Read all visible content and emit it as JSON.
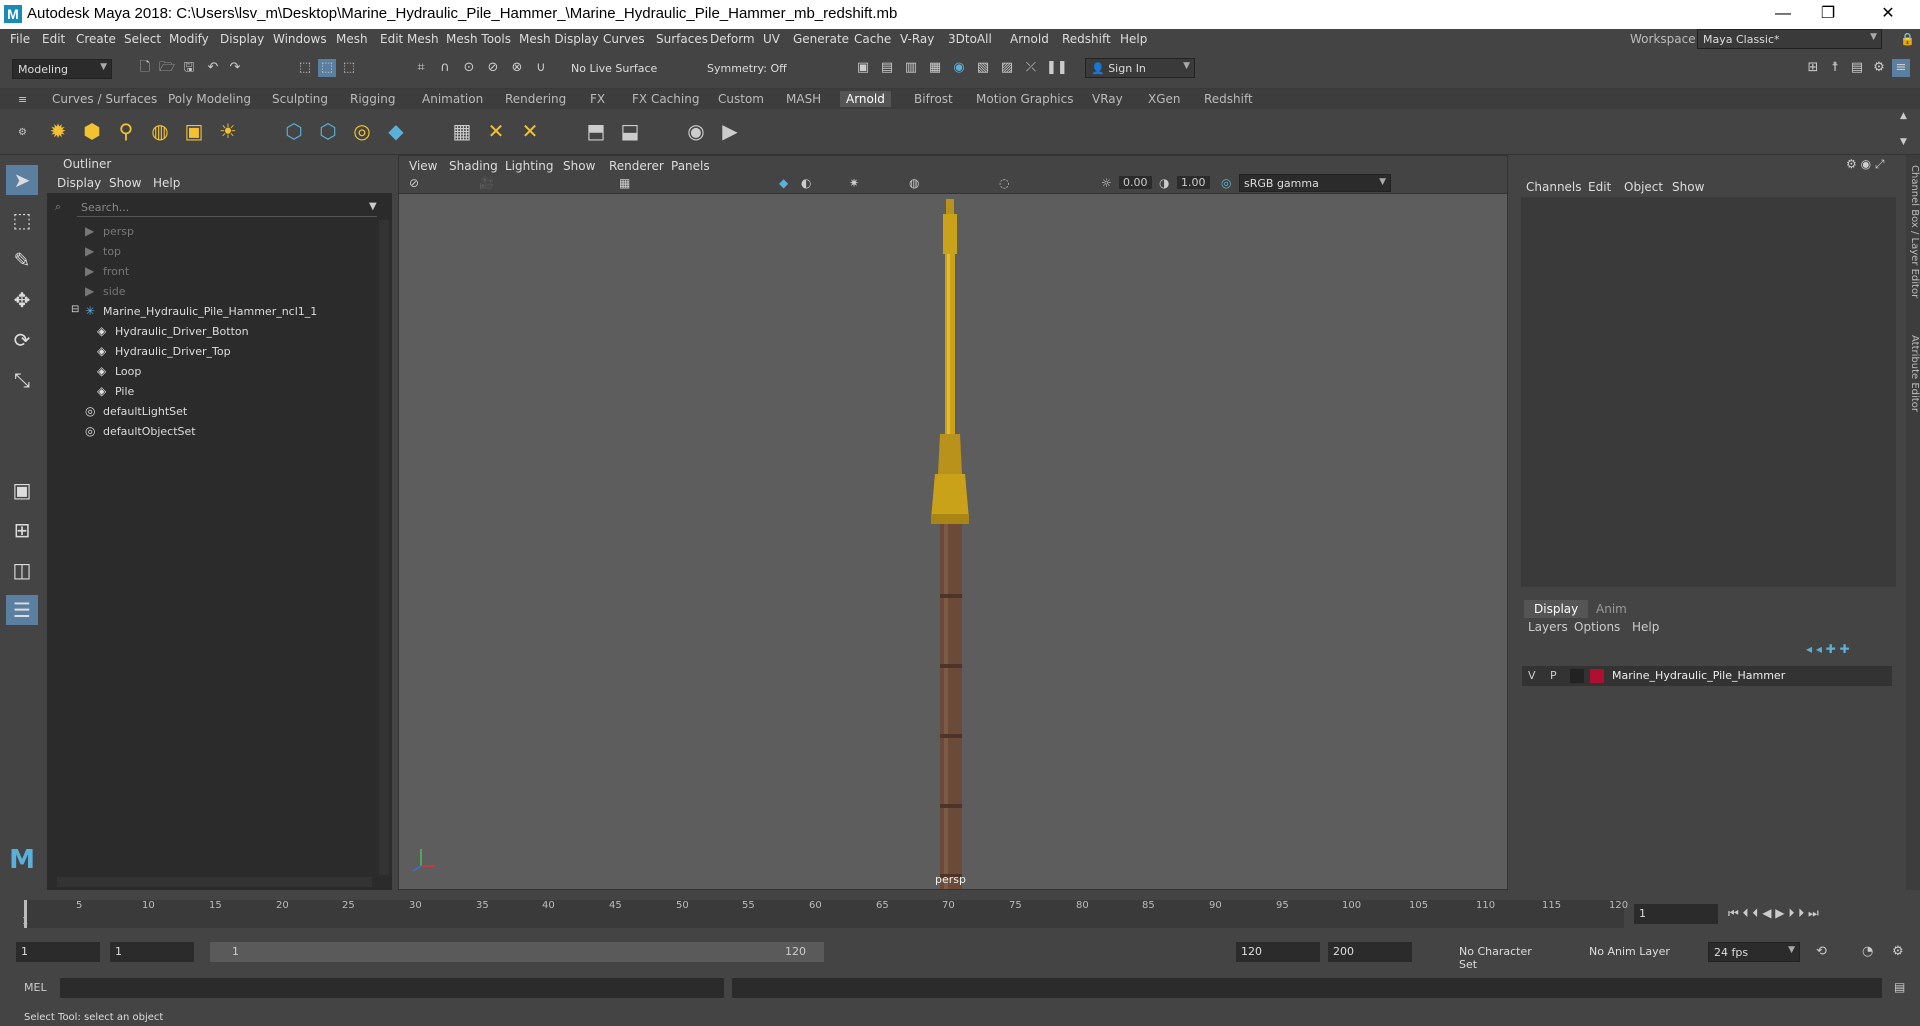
{
  "window": {
    "title": "Autodesk Maya 2018: C:\\Users\\lsv_m\\Desktop\\Marine_Hydraulic_Pile_Hammer_\\Marine_Hydraulic_Pile_Hammer_mb_redshift.mb",
    "app_icon": "M",
    "minimize_icon": "—",
    "restore_icon": "❐",
    "close_icon": "✕"
  },
  "menubar": [
    "File",
    "Edit",
    "Create",
    "Select",
    "Modify",
    "Display",
    "Windows",
    "Mesh",
    "Edit Mesh",
    "Mesh Tools",
    "Mesh Display",
    "Curves",
    "Surfaces",
    "Deform",
    "UV",
    "Generate",
    "Cache",
    "V-Ray",
    "3DtoAll",
    "Arnold",
    "Redshift",
    "Help"
  ],
  "workspace": {
    "label": "Workspace :",
    "value": "Maya Classic*"
  },
  "toolbar": {
    "mode": "Modeling",
    "live_surface": "No Live Surface",
    "symmetry": "Symmetry: Off",
    "sign_in": "Sign In"
  },
  "shelf_tabs": [
    "Curves / Surfaces",
    "Poly Modeling",
    "Sculpting",
    "Rigging",
    "Animation",
    "Rendering",
    "FX",
    "FX Caching",
    "Custom",
    "MASH",
    "Arnold",
    "Bifrost",
    "Motion Graphics",
    "VRay",
    "XGen",
    "Redshift"
  ],
  "shelf_active": "Arnold",
  "outliner": {
    "title": "Outliner",
    "menu": [
      "Display",
      "Show",
      "Help"
    ],
    "search_placeholder": "Search...",
    "items": [
      {
        "label": "persp",
        "icon": "camera-icon",
        "dim": true
      },
      {
        "label": "top",
        "icon": "camera-icon",
        "dim": true
      },
      {
        "label": "front",
        "icon": "camera-icon",
        "dim": true
      },
      {
        "label": "side",
        "icon": "camera-icon",
        "dim": true
      },
      {
        "label": "Marine_Hydraulic_Pile_Hammer_ncl1_1",
        "icon": "group-icon",
        "dim": false
      },
      {
        "label": "Hydraulic_Driver_Botton",
        "icon": "mesh-icon",
        "dim": false
      },
      {
        "label": "Hydraulic_Driver_Top",
        "icon": "mesh-icon",
        "dim": false
      },
      {
        "label": "Loop",
        "icon": "mesh-icon",
        "dim": false
      },
      {
        "label": "Pile",
        "icon": "mesh-icon",
        "dim": false
      },
      {
        "label": "defaultLightSet",
        "icon": "set-icon",
        "dim": false
      },
      {
        "label": "defaultObjectSet",
        "icon": "set-icon",
        "dim": false
      }
    ]
  },
  "viewport": {
    "menu": [
      "View",
      "Shading",
      "Lighting",
      "Show",
      "Renderer",
      "Panels"
    ],
    "exposure": "0.00",
    "gamma": "1.00",
    "colorspace": "sRGB gamma",
    "camera_label": "persp"
  },
  "channel_box": {
    "menu": [
      "Channels",
      "Edit",
      "Object",
      "Show"
    ]
  },
  "layer_editor": {
    "tabs": [
      "Display",
      "Anim"
    ],
    "menu": [
      "Layers",
      "Options",
      "Help"
    ],
    "layer": {
      "v": "V",
      "p": "P",
      "name": "Marine_Hydraulic_Pile_Hammer",
      "color": "#b01030"
    }
  },
  "side_tabs": [
    "Channel Box / Layer Editor",
    "Attribute Editor"
  ],
  "timeline": {
    "ticks": [
      "5",
      "10",
      "15",
      "20",
      "25",
      "30",
      "35",
      "40",
      "45",
      "50",
      "55",
      "60",
      "65",
      "70",
      "75",
      "80",
      "85",
      "90",
      "95",
      "100",
      "105",
      "110",
      "115",
      "120"
    ],
    "first_tick": "1",
    "current_frame": "1"
  },
  "range": {
    "start": "1",
    "start_inner": "1",
    "slider_start": "1",
    "slider_end": "120",
    "end_inner": "120",
    "end": "200",
    "character_set": "No Character Set",
    "anim_layer": "No Anim Layer",
    "fps": "24 fps"
  },
  "command_line": {
    "label": "MEL"
  },
  "help_line": "Select Tool: select an object",
  "colors": {
    "hammer_yellow": "#c9a21a",
    "pile_brown": "#6b4a3a",
    "active_blue": "#5ab0d8"
  }
}
